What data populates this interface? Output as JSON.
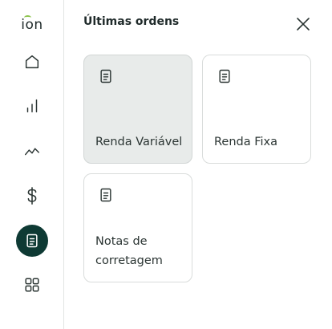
{
  "brand": {
    "logo_text": "ion",
    "accent_color": "#8bc34a",
    "dark_color": "#0e3a34"
  },
  "sidebar": {
    "items": [
      {
        "icon": "home-icon",
        "active": false
      },
      {
        "icon": "bar-chart-icon",
        "active": false
      },
      {
        "icon": "trend-line-icon",
        "active": false
      },
      {
        "icon": "dollar-icon",
        "active": false
      },
      {
        "icon": "document-icon",
        "active": true
      },
      {
        "icon": "grid-icon",
        "active": false
      }
    ]
  },
  "panel": {
    "title": "Últimas ordens",
    "close_icon": "close-icon"
  },
  "cards": [
    {
      "label": "Renda Variável",
      "icon": "document-icon",
      "selected": true
    },
    {
      "label": "Renda Fixa",
      "icon": "document-icon",
      "selected": false
    },
    {
      "label": "Notas de corretagem",
      "icon": "document-icon",
      "selected": false
    }
  ]
}
